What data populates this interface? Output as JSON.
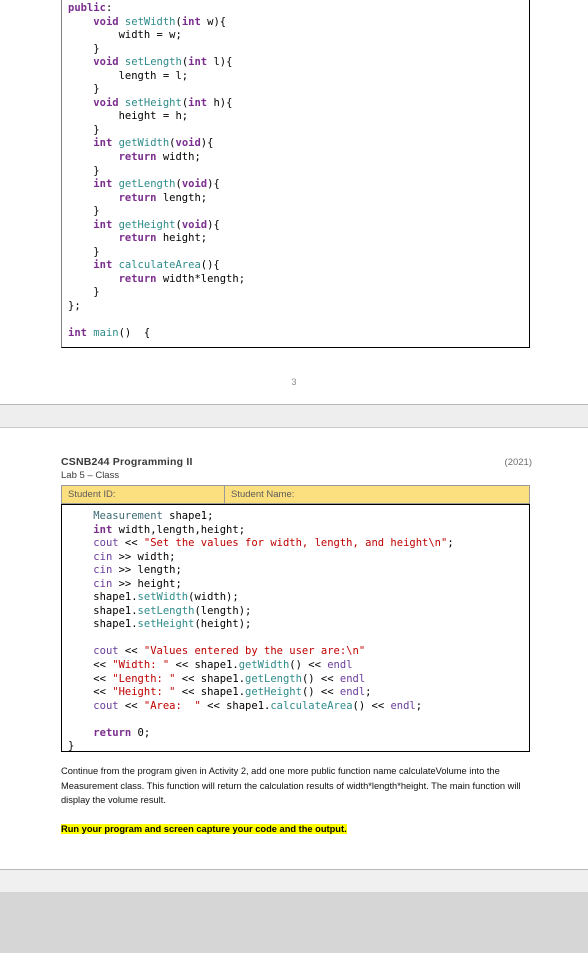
{
  "document": {
    "page_one": {
      "page_number": "3",
      "code_block": {
        "name": "measurement-class-code",
        "lines": [
          [
            {
              "t": "public",
              "c": "kw"
            },
            {
              "t": ":",
              "c": "pln"
            }
          ],
          [
            {
              "t": "    ",
              "c": "pln"
            },
            {
              "t": "void",
              "c": "kw"
            },
            {
              "t": " ",
              "c": "pln"
            },
            {
              "t": "setWidth",
              "c": "fn"
            },
            {
              "t": "(",
              "c": "pln"
            },
            {
              "t": "int",
              "c": "kw"
            },
            {
              "t": " w){",
              "c": "pln"
            }
          ],
          [
            {
              "t": "        width = w;",
              "c": "pln"
            }
          ],
          [
            {
              "t": "    }",
              "c": "pln"
            }
          ],
          [
            {
              "t": "    ",
              "c": "pln"
            },
            {
              "t": "void",
              "c": "kw"
            },
            {
              "t": " ",
              "c": "pln"
            },
            {
              "t": "setLength",
              "c": "fn"
            },
            {
              "t": "(",
              "c": "pln"
            },
            {
              "t": "int",
              "c": "kw"
            },
            {
              "t": " l){",
              "c": "pln"
            }
          ],
          [
            {
              "t": "        length = l;",
              "c": "pln"
            }
          ],
          [
            {
              "t": "    }",
              "c": "pln"
            }
          ],
          [
            {
              "t": "    ",
              "c": "pln"
            },
            {
              "t": "void",
              "c": "kw"
            },
            {
              "t": " ",
              "c": "pln"
            },
            {
              "t": "setHeight",
              "c": "fn"
            },
            {
              "t": "(",
              "c": "pln"
            },
            {
              "t": "int",
              "c": "kw"
            },
            {
              "t": " h){",
              "c": "pln"
            }
          ],
          [
            {
              "t": "        height = h;",
              "c": "pln"
            }
          ],
          [
            {
              "t": "    }",
              "c": "pln"
            }
          ],
          [
            {
              "t": "    ",
              "c": "pln"
            },
            {
              "t": "int",
              "c": "kw"
            },
            {
              "t": " ",
              "c": "pln"
            },
            {
              "t": "getWidth",
              "c": "fn"
            },
            {
              "t": "(",
              "c": "pln"
            },
            {
              "t": "void",
              "c": "kw"
            },
            {
              "t": "){",
              "c": "pln"
            }
          ],
          [
            {
              "t": "        ",
              "c": "pln"
            },
            {
              "t": "return",
              "c": "kw"
            },
            {
              "t": " width;",
              "c": "pln"
            }
          ],
          [
            {
              "t": "    }",
              "c": "pln"
            }
          ],
          [
            {
              "t": "    ",
              "c": "pln"
            },
            {
              "t": "int",
              "c": "kw"
            },
            {
              "t": " ",
              "c": "pln"
            },
            {
              "t": "getLength",
              "c": "fn"
            },
            {
              "t": "(",
              "c": "pln"
            },
            {
              "t": "void",
              "c": "kw"
            },
            {
              "t": "){",
              "c": "pln"
            }
          ],
          [
            {
              "t": "        ",
              "c": "pln"
            },
            {
              "t": "return",
              "c": "kw"
            },
            {
              "t": " length;",
              "c": "pln"
            }
          ],
          [
            {
              "t": "    }",
              "c": "pln"
            }
          ],
          [
            {
              "t": "    ",
              "c": "pln"
            },
            {
              "t": "int",
              "c": "kw"
            },
            {
              "t": " ",
              "c": "pln"
            },
            {
              "t": "getHeight",
              "c": "fn"
            },
            {
              "t": "(",
              "c": "pln"
            },
            {
              "t": "void",
              "c": "kw"
            },
            {
              "t": "){",
              "c": "pln"
            }
          ],
          [
            {
              "t": "        ",
              "c": "pln"
            },
            {
              "t": "return",
              "c": "kw"
            },
            {
              "t": " height;",
              "c": "pln"
            }
          ],
          [
            {
              "t": "    }",
              "c": "pln"
            }
          ],
          [
            {
              "t": "    ",
              "c": "pln"
            },
            {
              "t": "int",
              "c": "kw"
            },
            {
              "t": " ",
              "c": "pln"
            },
            {
              "t": "calculateArea",
              "c": "fn"
            },
            {
              "t": "(){",
              "c": "pln"
            }
          ],
          [
            {
              "t": "        ",
              "c": "pln"
            },
            {
              "t": "return",
              "c": "kw"
            },
            {
              "t": " width*length;",
              "c": "pln"
            }
          ],
          [
            {
              "t": "    }",
              "c": "pln"
            }
          ],
          [
            {
              "t": "};",
              "c": "pln"
            }
          ],
          [
            {
              "t": "",
              "c": "pln"
            }
          ],
          [
            {
              "t": "int",
              "c": "kw"
            },
            {
              "t": " ",
              "c": "pln"
            },
            {
              "t": "main",
              "c": "fn"
            },
            {
              "t": "()  {",
              "c": "pln"
            }
          ]
        ]
      }
    },
    "page_two": {
      "header": {
        "course_title": "CSNB244 Programming II",
        "year": "(2021)",
        "lab_title": "Lab 5 – Class"
      },
      "student_table": {
        "student_id_label": "Student ID:",
        "student_name_label": "Student Name:",
        "student_id_value": "",
        "student_name_value": ""
      },
      "code_block": {
        "name": "main-function-code",
        "lines": [
          [
            {
              "t": "    ",
              "c": "pln"
            },
            {
              "t": "Measurement",
              "c": "typ"
            },
            {
              "t": " shape1;",
              "c": "pln"
            }
          ],
          [
            {
              "t": "    ",
              "c": "pln"
            },
            {
              "t": "int",
              "c": "kw"
            },
            {
              "t": " width,length,height;",
              "c": "pln"
            }
          ],
          [
            {
              "t": "    ",
              "c": "pln"
            },
            {
              "t": "cout",
              "c": "op"
            },
            {
              "t": " << ",
              "c": "pln"
            },
            {
              "t": "\"Set the values for width, length, and height\\n\"",
              "c": "str"
            },
            {
              "t": ";",
              "c": "pln"
            }
          ],
          [
            {
              "t": "    ",
              "c": "pln"
            },
            {
              "t": "cin",
              "c": "op"
            },
            {
              "t": " >> width;",
              "c": "pln"
            }
          ],
          [
            {
              "t": "    ",
              "c": "pln"
            },
            {
              "t": "cin",
              "c": "op"
            },
            {
              "t": " >> length;",
              "c": "pln"
            }
          ],
          [
            {
              "t": "    ",
              "c": "pln"
            },
            {
              "t": "cin",
              "c": "op"
            },
            {
              "t": " >> height;",
              "c": "pln"
            }
          ],
          [
            {
              "t": "    shape1.",
              "c": "pln"
            },
            {
              "t": "setWidth",
              "c": "fn"
            },
            {
              "t": "(width);",
              "c": "pln"
            }
          ],
          [
            {
              "t": "    shape1.",
              "c": "pln"
            },
            {
              "t": "setLength",
              "c": "fn"
            },
            {
              "t": "(length);",
              "c": "pln"
            }
          ],
          [
            {
              "t": "    shape1.",
              "c": "pln"
            },
            {
              "t": "setHeight",
              "c": "fn"
            },
            {
              "t": "(height);",
              "c": "pln"
            }
          ],
          [
            {
              "t": "",
              "c": "pln"
            }
          ],
          [
            {
              "t": "    ",
              "c": "pln"
            },
            {
              "t": "cout",
              "c": "op"
            },
            {
              "t": " << ",
              "c": "pln"
            },
            {
              "t": "\"Values entered by the user are:\\n\"",
              "c": "str"
            }
          ],
          [
            {
              "t": "    << ",
              "c": "pln"
            },
            {
              "t": "\"Width: \"",
              "c": "str"
            },
            {
              "t": " << shape1.",
              "c": "pln"
            },
            {
              "t": "getWidth",
              "c": "fn"
            },
            {
              "t": "() << ",
              "c": "pln"
            },
            {
              "t": "endl",
              "c": "op"
            }
          ],
          [
            {
              "t": "    << ",
              "c": "pln"
            },
            {
              "t": "\"Length: \"",
              "c": "str"
            },
            {
              "t": " << shape1.",
              "c": "pln"
            },
            {
              "t": "getLength",
              "c": "fn"
            },
            {
              "t": "() << ",
              "c": "pln"
            },
            {
              "t": "endl",
              "c": "op"
            }
          ],
          [
            {
              "t": "    << ",
              "c": "pln"
            },
            {
              "t": "\"Height: \"",
              "c": "str"
            },
            {
              "t": " << shape1.",
              "c": "pln"
            },
            {
              "t": "getHeight",
              "c": "fn"
            },
            {
              "t": "() << ",
              "c": "pln"
            },
            {
              "t": "endl",
              "c": "op"
            },
            {
              "t": ";",
              "c": "pln"
            }
          ],
          [
            {
              "t": "    ",
              "c": "pln"
            },
            {
              "t": "cout",
              "c": "op"
            },
            {
              "t": " << ",
              "c": "pln"
            },
            {
              "t": "\"Area:  \"",
              "c": "str"
            },
            {
              "t": " << shape1.",
              "c": "pln"
            },
            {
              "t": "calculateArea",
              "c": "fn"
            },
            {
              "t": "() << ",
              "c": "pln"
            },
            {
              "t": "endl",
              "c": "op"
            },
            {
              "t": ";",
              "c": "pln"
            }
          ],
          [
            {
              "t": "",
              "c": "pln"
            }
          ],
          [
            {
              "t": "    ",
              "c": "pln"
            },
            {
              "t": "return",
              "c": "kw"
            },
            {
              "t": " 0;",
              "c": "pln"
            }
          ],
          [
            {
              "t": "}",
              "c": "pln"
            }
          ]
        ]
      },
      "instructions": {
        "paragraph": "Continue from the program given in Activity 2, add one more public function name calculateVolume into the Measurement class. This function will return the calculation results of width*length*height. The main function will display the volume result.",
        "highlighted_task": "Run your program and screen capture your code and the output."
      }
    }
  },
  "colors": {
    "highlight": "#ffff00",
    "table_fill": "#fcdf7e",
    "keyword": "#7b2e8e",
    "function": "#2e8b8b",
    "string": "#c00000",
    "stream": "#6a3d9a",
    "backdrop": "#d6d6d6"
  }
}
